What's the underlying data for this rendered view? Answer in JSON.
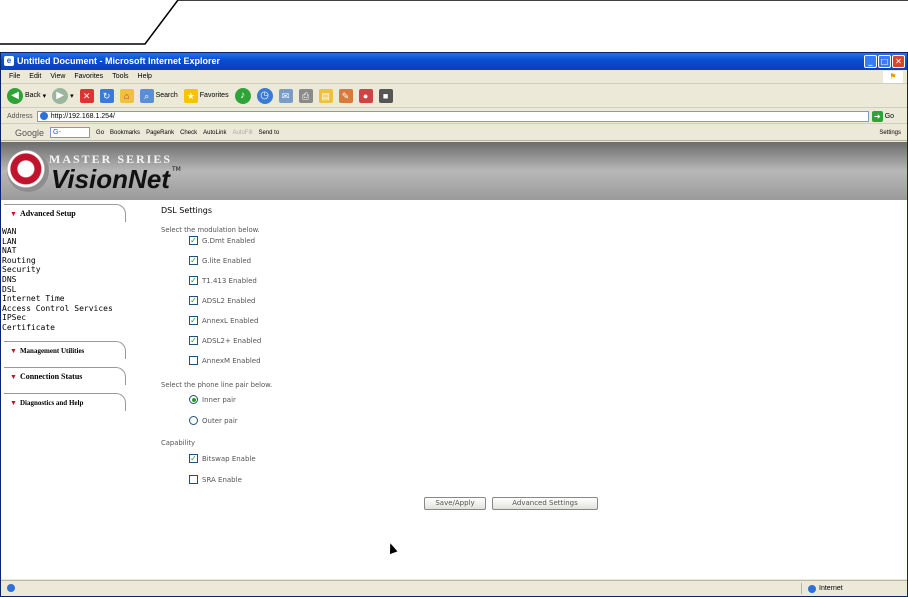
{
  "window": {
    "title": "Untitled Document - Microsoft Internet Explorer",
    "controls": [
      "minimize",
      "maximize",
      "close"
    ]
  },
  "menu": [
    "File",
    "Edit",
    "View",
    "Favorites",
    "Tools",
    "Help"
  ],
  "toolbar": {
    "back": "Back",
    "search": "Search",
    "favorites": "Favorites"
  },
  "address": {
    "label": "Address",
    "url": "http://192.168.1.254/",
    "go": "Go"
  },
  "google_toolbar": {
    "logo": "Google",
    "input": "G-",
    "items": [
      "Go",
      "Bookmarks",
      "PageRank",
      "Check",
      "AutoLink",
      "AutoFill",
      "Send to"
    ],
    "settings": "Settings"
  },
  "banner": {
    "series": "MASTER SERIES",
    "brand": "VisionNet",
    "tm": "TM"
  },
  "sidebar": {
    "advanced_setup": "Advanced Setup",
    "links": [
      "WAN",
      "LAN",
      "NAT",
      "Routing",
      "Security",
      "DNS",
      "DSL",
      "Internet Time",
      "Access Control Services",
      "IPSec",
      "Certificate"
    ],
    "management": "Management Utilities",
    "connection": "Connection Status",
    "diagnostics": "Diagnostics and Help"
  },
  "main": {
    "title": "DSL Settings",
    "modulation_instruction": "Select the modulation below.",
    "modulations": [
      {
        "label": "G.Dmt Enabled",
        "checked": true
      },
      {
        "label": "G.lite Enabled",
        "checked": true
      },
      {
        "label": "T1.413 Enabled",
        "checked": true
      },
      {
        "label": "ADSL2 Enabled",
        "checked": true
      },
      {
        "label": "AnnexL Enabled",
        "checked": true
      },
      {
        "label": "ADSL2+ Enabled",
        "checked": true
      },
      {
        "label": "AnnexM Enabled",
        "checked": false
      }
    ],
    "phone_instruction": "Select the phone line pair below.",
    "phone_pairs": [
      {
        "label": "Inner pair",
        "selected": true
      },
      {
        "label": "Outer pair",
        "selected": false
      }
    ],
    "capability_label": "Capability",
    "capabilities": [
      {
        "label": "Bitswap Enable",
        "checked": true
      },
      {
        "label": "SRA Enable",
        "checked": false
      }
    ],
    "save_button": "Save/Apply",
    "advanced_button": "Advanced Settings"
  },
  "statusbar": {
    "zone": "Internet"
  },
  "icons": {
    "back": "back-arrow-icon",
    "forward": "forward-arrow-icon",
    "stop": "stop-icon",
    "refresh": "refresh-icon",
    "home": "home-icon",
    "search": "search-icon",
    "favorites": "star-icon",
    "media": "media-icon",
    "history": "history-icon",
    "mail": "mail-icon",
    "print": "print-icon"
  }
}
